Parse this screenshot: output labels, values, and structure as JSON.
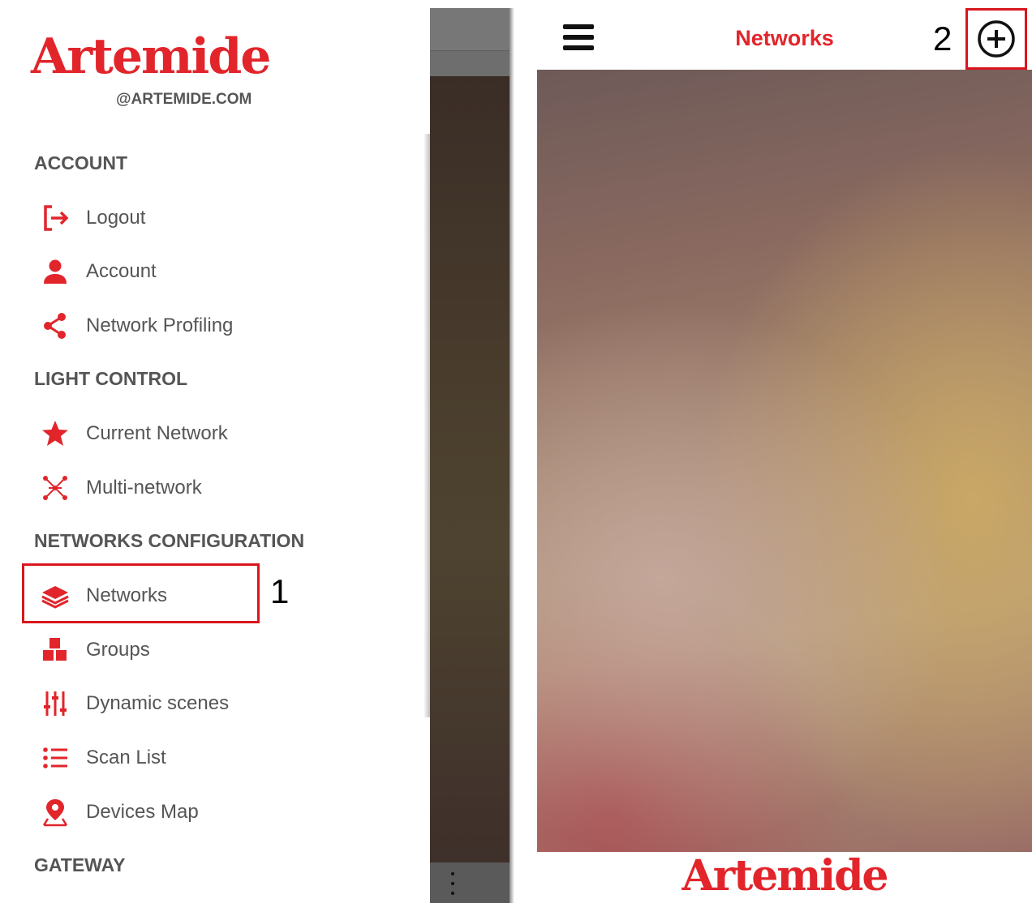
{
  "drawer": {
    "logo": "Artemide",
    "logo_sub": "@ARTEMIDE.COM",
    "sections": {
      "account": "ACCOUNT",
      "light_control": "LIGHT CONTROL",
      "networks_config": "NETWORKS CONFIGURATION",
      "gateway": "GATEWAY"
    },
    "items": {
      "logout": "Logout",
      "account": "Account",
      "network_profiling": "Network Profiling",
      "current_network": "Current Network",
      "multi_network": "Multi-network",
      "networks": "Networks",
      "groups": "Groups",
      "dynamic_scenes": "Dynamic scenes",
      "scan_list": "Scan List",
      "devices_map": "Devices Map"
    }
  },
  "annotations": {
    "step1": "1",
    "step2": "2"
  },
  "screen": {
    "title": "Networks",
    "footer_logo": "Artemide"
  },
  "colors": {
    "accent": "#e1252b",
    "highlight": "#d9161e",
    "text": "#555555"
  },
  "icons": [
    "logout-icon",
    "account-icon",
    "share-icon",
    "star-icon",
    "multi-network-icon",
    "layers-icon",
    "groups-icon",
    "sliders-icon",
    "list-icon",
    "map-pin-icon",
    "menu-icon",
    "add-circle-icon"
  ]
}
